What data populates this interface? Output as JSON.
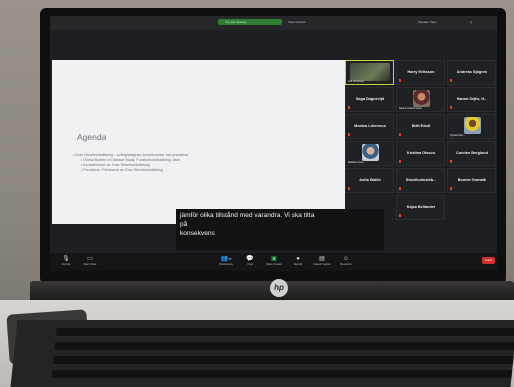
{
  "zoom": {
    "share_status": "You are viewing ...",
    "view_options": "View Options",
    "speaker_view": "Speaker View",
    "window_controls": "[] ..."
  },
  "slide": {
    "title": "Agenda",
    "bullets": [
      "Grav Hörselnedsättning – svårighetsgrad, konsekvenser och prevalens",
      "Global Burden of Disease Study: Funktionsnedsättning, data",
      "Konsekvenser av Grav Hörselnedsättning",
      "Prevalens / Förekomst av Grav Hörselnedsättning"
    ]
  },
  "participants": [
    {
      "name": "",
      "label": "Jeff Lönnberg",
      "video": true
    },
    {
      "name": "Harry Eriksson",
      "label": ""
    },
    {
      "name": "Andreas Sjögren",
      "label": ""
    },
    {
      "name": "Saga Dagnevijd",
      "label": ""
    },
    {
      "name": "",
      "label": "Sanna Guttormsson",
      "video": true
    },
    {
      "name": "Hanna Sejfiz, H...",
      "label": ""
    },
    {
      "name": "Monica Lönnroos",
      "label": ""
    },
    {
      "name": "Britt Edulf",
      "label": ""
    },
    {
      "name": "",
      "label": "Sylvia Fäst...",
      "video": true
    },
    {
      "name": "",
      "label": "Mattias Löwe...",
      "video": true
    },
    {
      "name": "Kristina Olsson",
      "label": ""
    },
    {
      "name": "Carolen Berglund",
      "label": ""
    },
    {
      "name": "Anita Wallin",
      "label": ""
    },
    {
      "name": "Stockholmsbib...",
      "label": ""
    },
    {
      "name": "Bonnie Granath",
      "label": ""
    },
    {
      "name": "Kajsa Bellander",
      "label": ""
    }
  ],
  "caption": {
    "line1": "jämför olika tillstånd med varandra. Vi ska titta",
    "line2": "på",
    "line3": "konsekvens"
  },
  "toolbar": {
    "unmute": "Unmute",
    "start_video": "Start Video",
    "participants": "Participants",
    "chat": "Chat",
    "share_screen": "Share Screen",
    "record": "Record",
    "closed_caption": "Closed Caption",
    "reactions": "Reactions",
    "participants_count": "25",
    "end": "Leave"
  },
  "laptop": {
    "brand": "hp"
  }
}
